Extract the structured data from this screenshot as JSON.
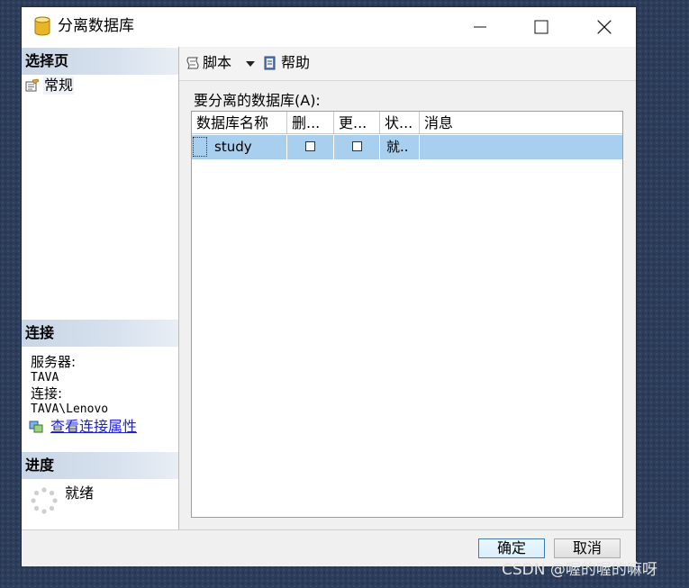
{
  "window": {
    "title": "分离数据库"
  },
  "sidebar": {
    "select_page": {
      "heading": "选择页",
      "items": [
        {
          "label": "常规"
        }
      ]
    },
    "connection": {
      "heading": "连接",
      "server_label": "服务器:",
      "server_value": "TAVA",
      "conn_label": "连接:",
      "conn_value": "TAVA\\Lenovo",
      "link_label": "查看连接属性"
    },
    "progress": {
      "heading": "进度",
      "status": "就绪"
    }
  },
  "toolbar": {
    "script_label": "脚本",
    "help_label": "帮助"
  },
  "grid": {
    "caption": "要分离的数据库(A):",
    "columns": [
      "数据库名称",
      "删...",
      "更...",
      "状...",
      "消息"
    ],
    "rows": [
      {
        "name": "study",
        "drop": false,
        "update": false,
        "status": "就..",
        "message": ""
      }
    ]
  },
  "footer": {
    "ok_label": "确定",
    "cancel_label": "取消"
  },
  "watermark": "CSDN @喔的喔的嘛呀",
  "colors": {
    "selected_row": "#a9cfee",
    "section_header": "#c9d6e6",
    "link": "#1a24c8",
    "desktop": "#2c3e5c"
  }
}
